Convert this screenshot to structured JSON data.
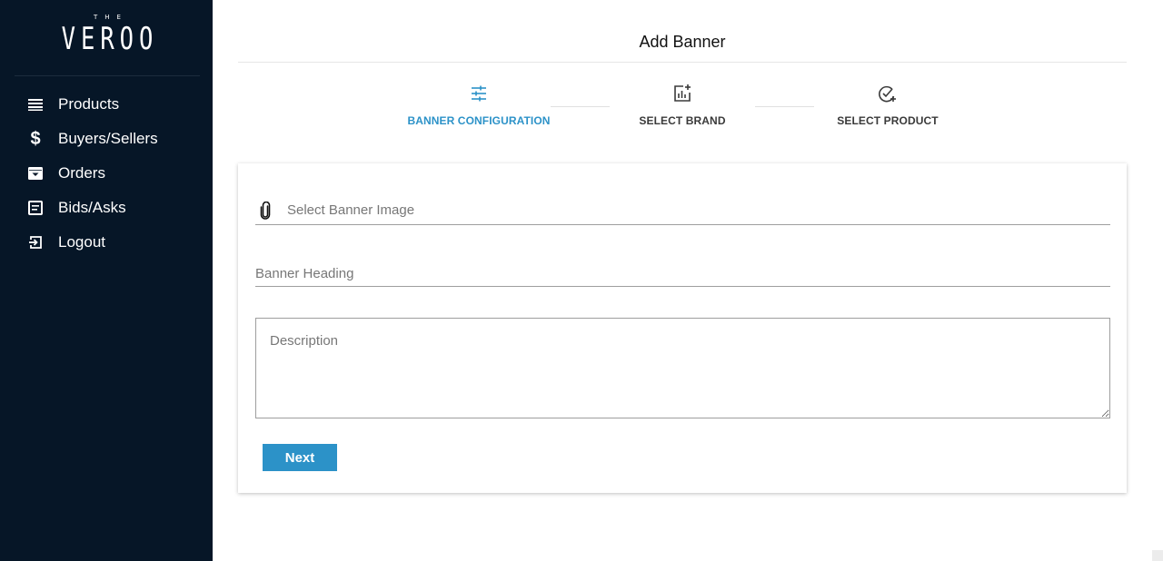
{
  "brand": {
    "small": "THE",
    "main": "VEROO"
  },
  "sidebar": {
    "items": [
      {
        "label": "Products",
        "icon": "list-icon"
      },
      {
        "label": "Buyers/Sellers",
        "icon": "dollar-icon"
      },
      {
        "label": "Orders",
        "icon": "archive-box-icon"
      },
      {
        "label": "Bids/Asks",
        "icon": "document-lines-icon"
      },
      {
        "label": "Logout",
        "icon": "exit-icon"
      }
    ]
  },
  "header": {
    "title": "Add Banner"
  },
  "stepper": {
    "steps": [
      {
        "label": "BANNER CONFIGURATION",
        "icon": "tune-sliders-icon",
        "active": true
      },
      {
        "label": "SELECT BRAND",
        "icon": "add-chart-icon",
        "active": false
      },
      {
        "label": "SELECT PRODUCT",
        "icon": "check-add-icon",
        "active": false
      }
    ]
  },
  "form": {
    "image_placeholder": "Select Banner Image",
    "heading_placeholder": "Banner Heading",
    "description_placeholder": "Description",
    "next_label": "Next"
  },
  "colors": {
    "sidebar_bg": "#061627",
    "accent": "#2c92c8",
    "text": "#212121"
  }
}
